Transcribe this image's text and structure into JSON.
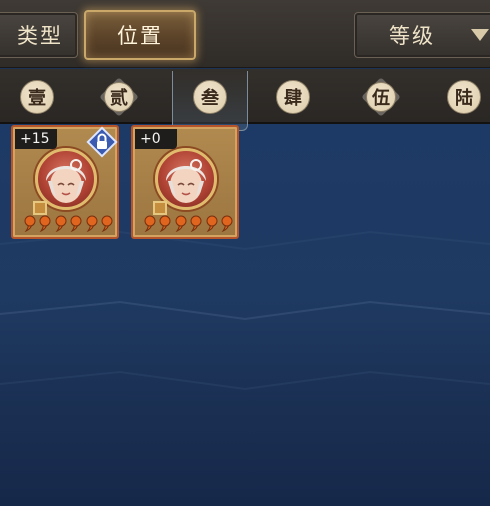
{
  "header": {
    "type_tab_label": "类型",
    "position_tab_label": "位置",
    "level_select_label": "等级"
  },
  "position_filters": [
    {
      "label": "壹",
      "icon": "round-medallion",
      "selected": false
    },
    {
      "label": "贰",
      "icon": "diamond-medallion",
      "selected": false
    },
    {
      "label": "叁",
      "icon": "round-medallion",
      "selected": true
    },
    {
      "label": "肆",
      "icon": "round-medallion",
      "selected": false
    },
    {
      "label": "伍",
      "icon": "diamond-medallion",
      "selected": false
    },
    {
      "label": "陆",
      "icon": "round-medallion",
      "selected": false
    }
  ],
  "heroes": [
    {
      "level": "+15",
      "locked": true,
      "stars": 6,
      "portrait": "white-haired-hero-portrait"
    },
    {
      "level": "+0",
      "locked": false,
      "stars": 6,
      "portrait": "white-haired-hero-portrait"
    }
  ],
  "colors": {
    "accent_gold": "#c9a86a",
    "card_border": "#b5542b",
    "star_orange": "#e0661f",
    "background_blue": "#1d3a66",
    "lock_badge": "#3b5bb0"
  }
}
